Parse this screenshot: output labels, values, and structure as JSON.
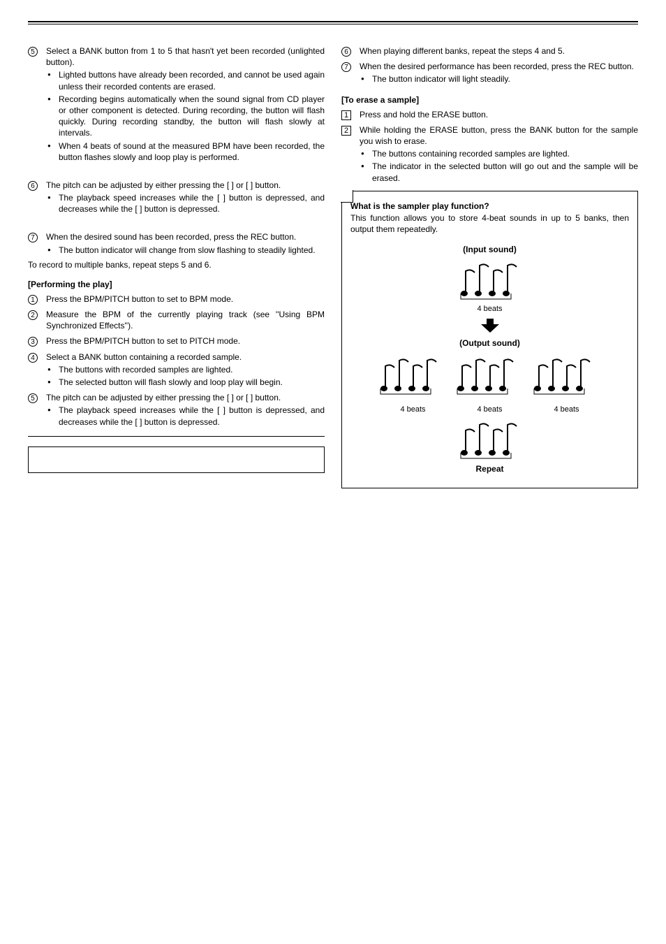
{
  "left": {
    "step_bank_num": "5",
    "step_bank_lead": "Select a BANK button from 1 to 5 that hasn't yet been recorded (unlighted button).",
    "bank_bullets": [
      "Lighted                       buttons have already been recorded, and cannot be used again unless their recorded contents are erased.",
      "Recording begins automatically when the sound signal from CD player or other component is detected. During recording, the                   button will flash quickly. During recording standby, the button will flash slowly at intervals.",
      "When 4 beats of sound at the measured BPM have been recorded, the                       button flashes slowly and loop play is performed."
    ],
    "pitch_num": "6",
    "pitch_body": "The pitch can be adjusted by either pressing the [ ] or [ ] button.",
    "pitch_bullet": "The playback speed increases while the [ ] button is depressed, and decreases while the [ ] button is depressed.",
    "rec_num": "7",
    "rec_body": "When the desired sound has been recorded, press the REC button.",
    "rec_bullet": "The                       button indicator will change from slow flashing to steadily lighted.",
    "multi_note": "To record to multiple banks, repeat steps 5 and 6.",
    "play_title": "[Performing the play]",
    "play_steps": {
      "s1_num": "1",
      "s1": "Press the BPM/PITCH button to set to BPM mode.",
      "s2_num": "2",
      "s2": "Measure the BPM of the currently playing track (see ''Using BPM Synchronized Effects'').",
      "s3_num": "3",
      "s3": "Press the BPM/PITCH button to set to PITCH mode.",
      "s4_num": "4",
      "s4": "Select a BANK button containing a recorded sample.",
      "s4_bullets": [
        "The                       buttons with recorded samples are lighted.",
        "The selected button will flash slowly and loop play will begin."
      ],
      "s5_num": "5",
      "s5": "The pitch can be adjusted by either pressing the [ ] or [ ] button.",
      "s5_bullet": "The playback speed increases while the [ ] button is depressed, and decreases while the [ ] button is depressed."
    },
    "hr_box_blank": ""
  },
  "right": {
    "s6_num": "6",
    "s6": "When playing different banks, repeat the steps 4 and 5.",
    "s7_num": "7",
    "s7": "When the desired performance has been recorded, press the REC button.",
    "s7_bullet": "The                       button indicator will light steadily.",
    "erase_title": "[To erase a sample]",
    "e1_num": "1",
    "e1": "Press and hold the ERASE button.",
    "e2_num": "2",
    "e2": "While holding the ERASE button, press the BANK button for the sample you wish to erase.",
    "e_bullets": [
      "The                       buttons containing recorded samples are lighted.",
      "The indicator in the selected                       button will go out and the sample will be erased."
    ],
    "panel_heading": "What is the sampler play function?",
    "panel_body": "This function allows you to store 4-beat sounds in up to 5 banks, then output them repeatedly.",
    "figure_labels": {
      "input": "(Input sound)",
      "beats": "4 beats",
      "output": "(Output sound)",
      "four": "4 beats",
      "four2": "4 beats",
      "four3": "4 beats",
      "repeat": "Repeat"
    }
  }
}
